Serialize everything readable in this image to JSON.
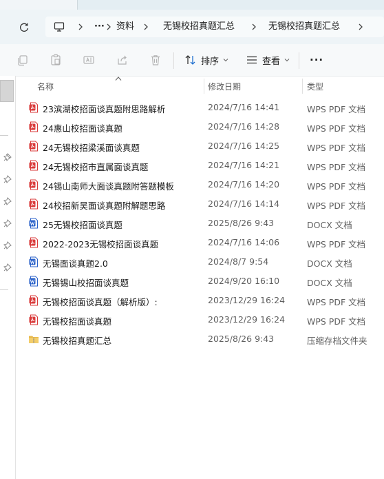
{
  "breadcrumb": {
    "more": "···",
    "items": [
      "资料",
      "无锡校招真题汇总",
      "无锡校招真题汇总"
    ]
  },
  "toolbar": {
    "sort_label": "排序",
    "view_label": "查看",
    "more": "···"
  },
  "columns": {
    "name": "名称",
    "modified": "修改日期",
    "type": "类型"
  },
  "colors": {
    "pdf": "#d93a3a",
    "docx": "#2b62c9",
    "folder": "#e8b84b",
    "accent": "#005fb8"
  },
  "files": [
    {
      "name": "23滨湖校招面谈真题附思路解析",
      "modified": "2024/7/16 14:41",
      "type": "WPS PDF 文档",
      "icon": "pdf-file-icon"
    },
    {
      "name": "24惠山校招面谈真题",
      "modified": "2024/7/16 14:28",
      "type": "WPS PDF 文档",
      "icon": "pdf-file-icon"
    },
    {
      "name": "24无锡校招梁溪面谈真题",
      "modified": "2024/7/16 14:25",
      "type": "WPS PDF 文档",
      "icon": "pdf-file-icon"
    },
    {
      "name": "24无锡校招市直属面谈真题",
      "modified": "2024/7/16 14:21",
      "type": "WPS PDF 文档",
      "icon": "pdf-file-icon"
    },
    {
      "name": "24锡山南师大面谈真题附答题模板",
      "modified": "2024/7/16 14:20",
      "type": "WPS PDF 文档",
      "icon": "pdf-file-icon"
    },
    {
      "name": "24校招新吴面谈真题附解题思路",
      "modified": "2024/7/16 14:14",
      "type": "WPS PDF 文档",
      "icon": "pdf-file-icon"
    },
    {
      "name": "25无锡校招面谈真题",
      "modified": "2025/8/26 9:43",
      "type": "DOCX 文档",
      "icon": "docx-file-icon"
    },
    {
      "name": "2022-2023无锡校招面谈真题",
      "modified": "2024/7/16 14:06",
      "type": "WPS PDF 文档",
      "icon": "pdf-file-icon"
    },
    {
      "name": "无锡面谈真题2.0",
      "modified": "2024/8/7 9:54",
      "type": "DOCX 文档",
      "icon": "docx-file-icon"
    },
    {
      "name": "无锡锡山校招面谈真题",
      "modified": "2024/9/20 16:10",
      "type": "DOCX 文档",
      "icon": "docx-file-icon"
    },
    {
      "name": "无锡校招面谈真题（解析版）:",
      "modified": "2023/12/29 16:24",
      "type": "WPS PDF 文档",
      "icon": "pdf-file-icon"
    },
    {
      "name": "无锡校招面谈真题",
      "modified": "2023/12/29 16:24",
      "type": "WPS PDF 文档",
      "icon": "pdf-file-icon"
    },
    {
      "name": "无锡校招真题汇总",
      "modified": "2025/8/26 9:43",
      "type": "压缩存档文件夹",
      "icon": "zip-folder-icon"
    }
  ]
}
